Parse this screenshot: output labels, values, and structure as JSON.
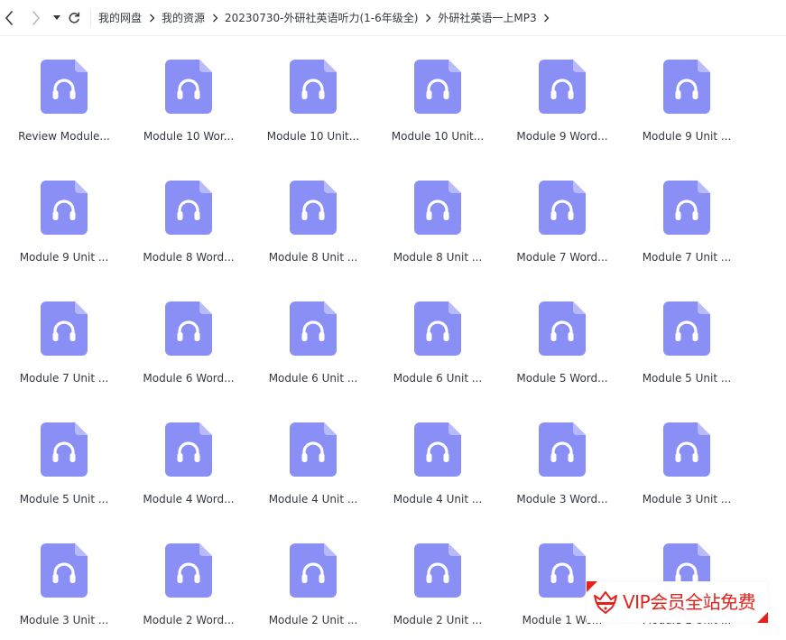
{
  "toolbar": {
    "back_icon": "chevron-left-icon",
    "forward_icon": "chevron-right-icon",
    "dropdown_icon": "caret-down-icon",
    "refresh_icon": "refresh-icon",
    "breadcrumb": [
      "我的网盘",
      "我的资源",
      "20230730-外研社英语听力(1-6年级全)",
      "外研社英语一上MP3"
    ]
  },
  "file_icon": {
    "name": "audio-file-icon",
    "color": "#8a8ff5",
    "fold_color": "#b8bbfa",
    "glyph_color": "#ffffff"
  },
  "files": [
    {
      "name": "Review Module..."
    },
    {
      "name": "Module 10 Wor..."
    },
    {
      "name": "Module 10 Unit..."
    },
    {
      "name": "Module 10 Unit..."
    },
    {
      "name": "Module 9 Word..."
    },
    {
      "name": "Module 9 Unit ..."
    },
    {
      "name": "Module 9 Unit ..."
    },
    {
      "name": "Module 8 Word..."
    },
    {
      "name": "Module 8 Unit ..."
    },
    {
      "name": "Module 8 Unit ..."
    },
    {
      "name": "Module 7 Word..."
    },
    {
      "name": "Module 7 Unit ..."
    },
    {
      "name": "Module 7 Unit ..."
    },
    {
      "name": "Module 6 Word..."
    },
    {
      "name": "Module 6 Unit ..."
    },
    {
      "name": "Module 6 Unit ..."
    },
    {
      "name": "Module 5 Word..."
    },
    {
      "name": "Module 5 Unit ..."
    },
    {
      "name": "Module 5 Unit ..."
    },
    {
      "name": "Module 4 Word..."
    },
    {
      "name": "Module 4 Unit ..."
    },
    {
      "name": "Module 4 Unit ..."
    },
    {
      "name": "Module 3 Word..."
    },
    {
      "name": "Module 3 Unit ..."
    },
    {
      "name": "Module 3 Unit ..."
    },
    {
      "name": "Module 2 Word..."
    },
    {
      "name": "Module 2 Unit ..."
    },
    {
      "name": "Module 2 Unit ..."
    },
    {
      "name": "Module 1 Wo..."
    },
    {
      "name": "Module 1 Unit ..."
    }
  ],
  "watermark": {
    "text": "VIP会员全站免费",
    "color": "#e4221b",
    "icon": "crown-heart-logo-icon"
  }
}
